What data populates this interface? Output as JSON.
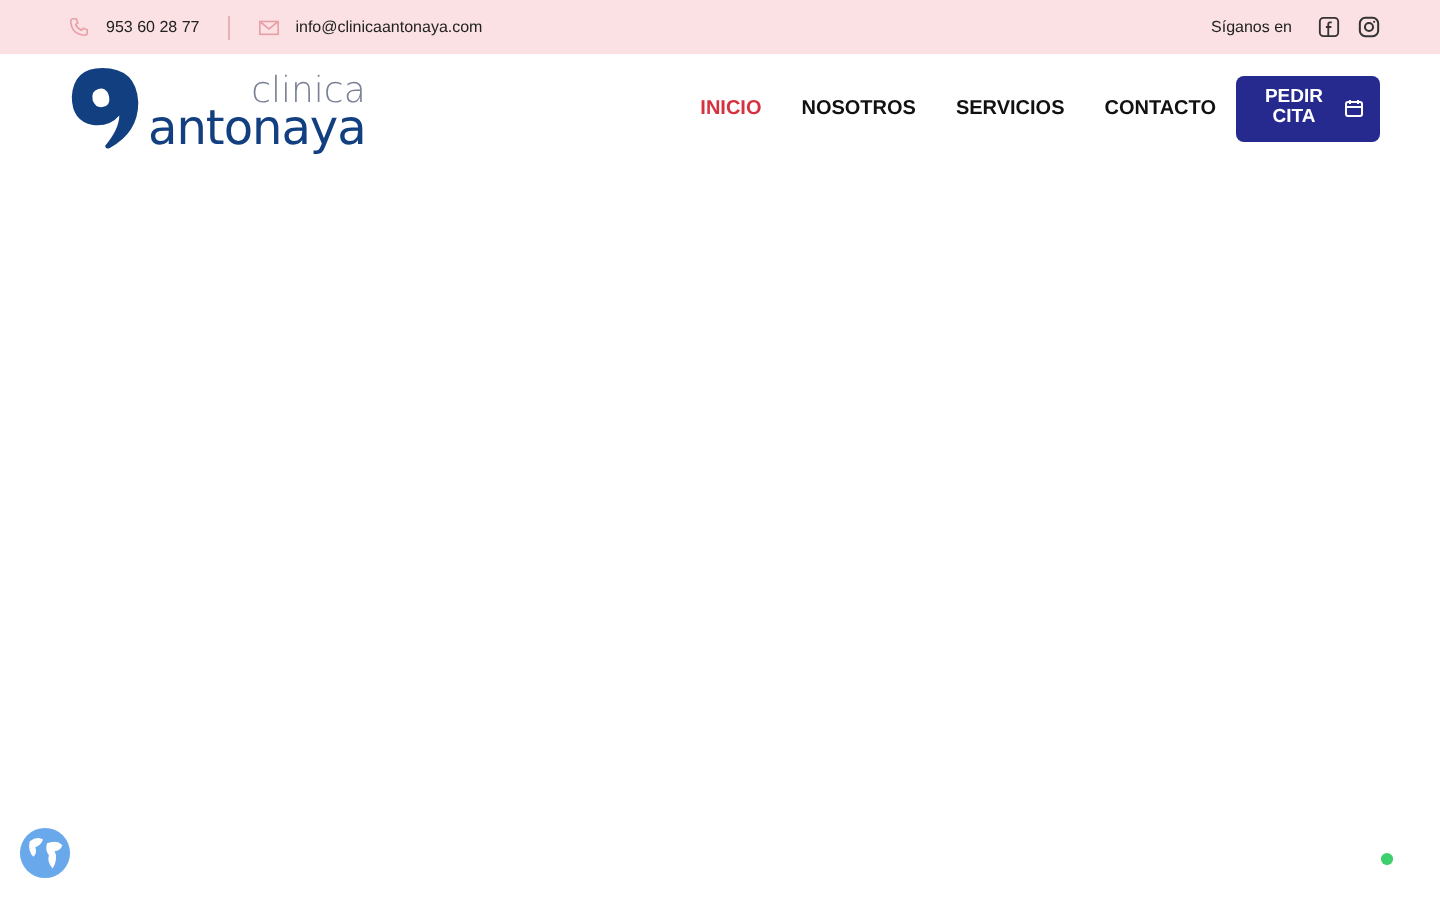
{
  "topbar": {
    "phone": "953 60 28 77",
    "email": "info@clinicaantonaya.com",
    "follow_label": "Síganos en"
  },
  "logo": {
    "line_1": "clinica",
    "line_2": "antonaya"
  },
  "nav": [
    {
      "label": "INICIO",
      "selected": true
    },
    {
      "label": "NOSOTROS",
      "selected": false
    },
    {
      "label": "SERVICIOS",
      "selected": false
    },
    {
      "label": "CONTACTO",
      "selected": false
    }
  ],
  "cta": {
    "label": "PEDIR CITA"
  }
}
